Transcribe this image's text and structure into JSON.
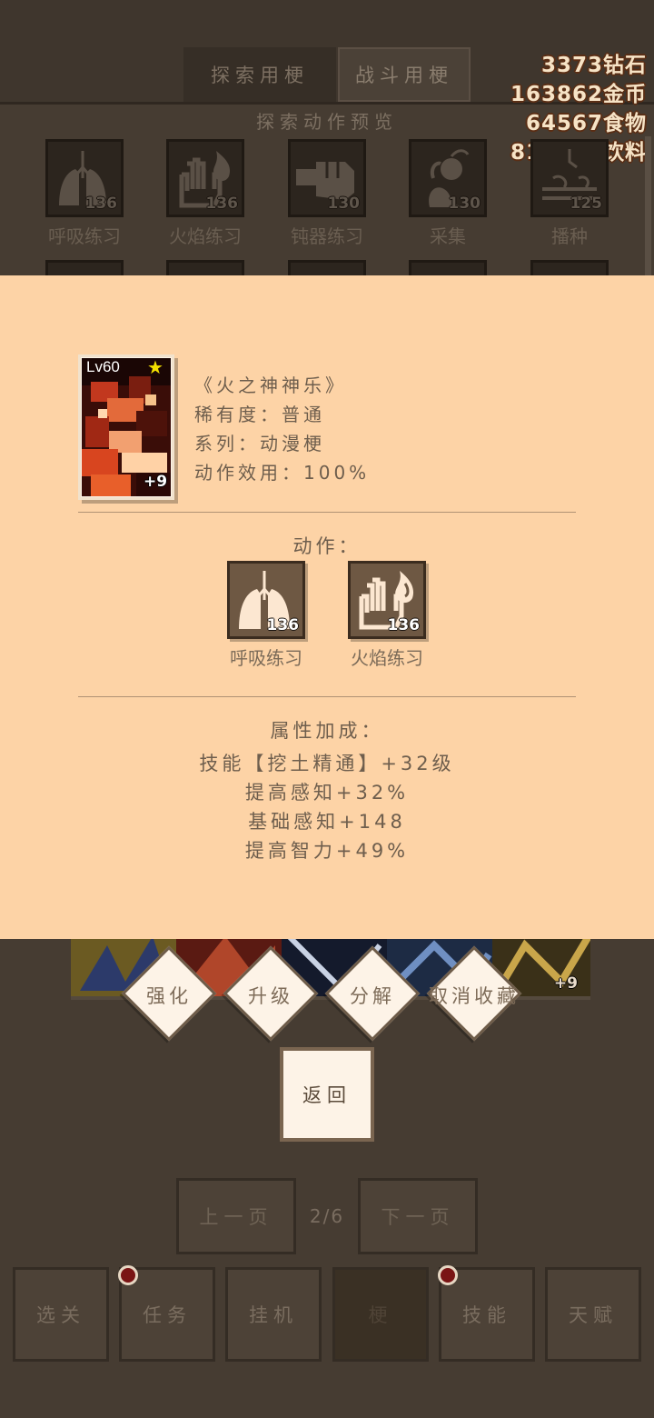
{
  "tabs": {
    "explore": "探索用梗",
    "battle": "战斗用梗"
  },
  "currency": {
    "diamonds": "3373钻石",
    "gold": "163862金币",
    "food": "64567食物",
    "drink": "818615饮料"
  },
  "preview_title": "探索动作预览",
  "actions": [
    {
      "name": "呼吸练习",
      "level": "136",
      "icon": "lungs-icon"
    },
    {
      "name": "火焰练习",
      "level": "136",
      "icon": "fire-hand-icon"
    },
    {
      "name": "钝器练习",
      "level": "130",
      "icon": "fist-icon"
    },
    {
      "name": "采集",
      "level": "130",
      "icon": "gather-plant-icon"
    },
    {
      "name": "播种",
      "level": "125",
      "icon": "sow-seed-icon"
    }
  ],
  "card": {
    "level": "Lv60",
    "star": "★",
    "plus": "+9",
    "title": "《火之神神乐》",
    "rarity": "稀有度：普通",
    "series": "系列：动漫梗",
    "efficiency": "动作效用：100%"
  },
  "modal_actions_label": "动作：",
  "modal_actions": [
    {
      "name": "呼吸练习",
      "level": "136",
      "icon": "lungs-icon"
    },
    {
      "name": "火焰练习",
      "level": "136",
      "icon": "fire-hand-icon"
    }
  ],
  "bonus_label": "属性加成：",
  "bonuses": [
    "技能【挖土精通】+32级",
    "提高感知+32%",
    "基础感知+148",
    "提高智力+49%"
  ],
  "strip_plus": "+9",
  "card_actions": [
    "强化",
    "升级",
    "分解",
    "取消收藏"
  ],
  "back": "返回",
  "pager": {
    "prev": "上一页",
    "indicator": "2/6",
    "next": "下一页"
  },
  "nav": [
    "选关",
    "任务",
    "挂机",
    "梗",
    "技能",
    "天赋"
  ],
  "colors": {
    "modal_bg": "#fdd3a6",
    "background": "#463c32",
    "badge": "#7a1414"
  }
}
